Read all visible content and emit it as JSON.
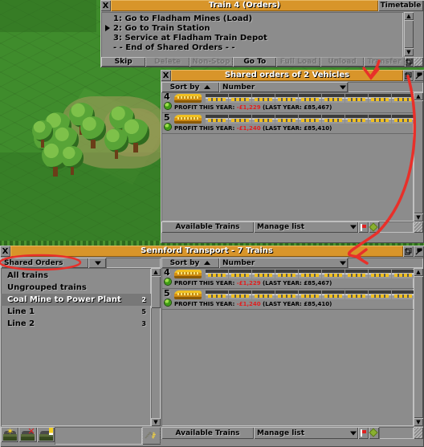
{
  "game": "OpenTTD",
  "orders_window": {
    "title": "Train 4 (Orders)",
    "close_label": "X",
    "timetable_tab": "Timetable",
    "orders": [
      {
        "text": "1: Go to Fladham Mines (Load)",
        "current": false
      },
      {
        "text": "2: Go to Train Station",
        "current": true
      },
      {
        "text": "3: Service at Fladham Train Depot",
        "current": false
      },
      {
        "text": "- - End of Shared Orders - -",
        "current": false
      }
    ],
    "buttons": [
      {
        "label": "Skip",
        "enabled": true
      },
      {
        "label": "Delete",
        "enabled": false
      },
      {
        "label": "Non-Stop",
        "enabled": false
      },
      {
        "label": "Go To",
        "enabled": true
      },
      {
        "label": "Full Load",
        "enabled": false
      },
      {
        "label": "Unload",
        "enabled": false
      },
      {
        "label": "Transfer",
        "enabled": false
      }
    ],
    "shade_icon": "shade-window-icon",
    "resize_icon": "resize-grip-icon"
  },
  "shared_orders_window": {
    "title": "Shared orders of 2 Vehicles",
    "close_label": "X",
    "sort_label": "Sort by",
    "sort_criteria": "Number",
    "sort_direction_icon": "sort-ascending-icon",
    "shade_icon": "shade-window-icon",
    "sticky_icon": "sticky-pin-icon",
    "vehicles": [
      {
        "number": "4",
        "status_icon": "green-status-led",
        "profit_label": "PROFIT THIS YEAR:",
        "profit_value": "-£1,229",
        "last_year": "(LAST YEAR: £85,467)",
        "wagons": 9
      },
      {
        "number": "5",
        "status_icon": "green-status-led",
        "profit_label": "PROFIT THIS YEAR:",
        "profit_value": "-£1,240",
        "last_year": "(LAST YEAR: £85,410)",
        "wagons": 9
      }
    ],
    "footer": {
      "available_trains": "Available Trains",
      "manage_list": "Manage list",
      "flag_icon": "stop-start-flag-icon",
      "replace_icon": "replace-vehicles-icon"
    }
  },
  "company_window": {
    "title": "Sennford Transport - 7 Trains",
    "close_label": "X",
    "shade_icon": "shade-window-icon",
    "sticky_icon": "sticky-pin-icon",
    "group_filter": "Shared Orders",
    "groups": [
      {
        "name": "All trains",
        "count": "",
        "selected": false
      },
      {
        "name": "Ungrouped trains",
        "count": "",
        "selected": false
      },
      {
        "name": "Coal Mine to Power Plant",
        "count": "2",
        "selected": true
      },
      {
        "name": "Line 1",
        "count": "5",
        "selected": false
      },
      {
        "name": "Line 2",
        "count": "3",
        "selected": false
      }
    ],
    "group_toolbar": [
      {
        "icon": "create-group-icon",
        "enabled": true
      },
      {
        "icon": "delete-group-icon",
        "enabled": true
      },
      {
        "icon": "rename-group-icon",
        "enabled": true
      },
      {
        "icon": "replace-protect-icon",
        "enabled": false
      }
    ],
    "sort_label": "Sort by",
    "sort_criteria": "Number",
    "sort_direction_icon": "sort-ascending-icon",
    "vehicles": [
      {
        "number": "4",
        "status_icon": "green-status-led",
        "profit_label": "PROFIT THIS YEAR:",
        "profit_value": "-£1,229",
        "last_year": "(LAST YEAR: £85,467)",
        "wagons": 9
      },
      {
        "number": "5",
        "status_icon": "green-status-led",
        "profit_label": "PROFIT THIS YEAR:",
        "profit_value": "-£1,240",
        "last_year": "(LAST YEAR: £85,410)",
        "wagons": 9
      }
    ],
    "footer": {
      "available_trains": "Available Trains",
      "manage_list": "Manage list",
      "flag_icon": "stop-start-flag-icon",
      "replace_icon": "replace-vehicles-icon"
    }
  },
  "annotations": {
    "color": "#e8302a",
    "ellipse_target": "Shared Orders",
    "arrow_count": 2
  },
  "colors": {
    "title_active": "#d8952a",
    "window_bg": "#8c8c8c",
    "negative": "#e02020",
    "led_green": "#3f9c14",
    "annotation_red": "#e8302a"
  }
}
